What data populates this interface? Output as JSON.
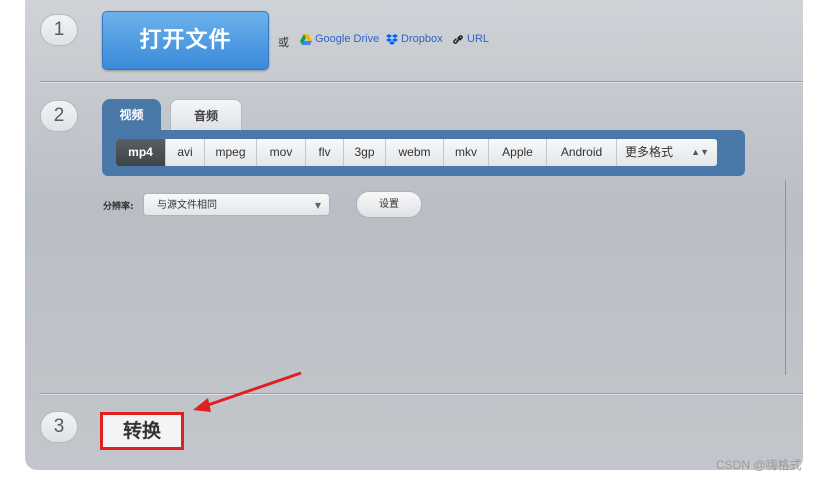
{
  "steps": {
    "one": "1",
    "two": "2",
    "three": "3"
  },
  "open_file": {
    "label": "打开文件"
  },
  "or_text": "或",
  "sources": [
    {
      "label": "Google Drive",
      "icon": "google-drive-icon"
    },
    {
      "label": "Dropbox",
      "icon": "dropbox-icon"
    },
    {
      "label": "URL",
      "icon": "link-icon"
    }
  ],
  "tabs": {
    "video": "视频",
    "audio": "音频"
  },
  "formats": [
    "mp4",
    "avi",
    "mpeg",
    "mov",
    "flv",
    "3gp",
    "webm",
    "mkv",
    "Apple",
    "Android"
  ],
  "selected_format": "mp4",
  "more_formats": "更多格式",
  "resolution": {
    "label": "分辨率:",
    "value": "与源文件相同"
  },
  "settings_label": "设置",
  "convert_label": "转换",
  "watermark": "CSDN @嗨格式",
  "colors": {
    "accent_blue": "#3a8ad9",
    "tab_blue": "#4a78a8",
    "highlight_red": "#e02020"
  }
}
